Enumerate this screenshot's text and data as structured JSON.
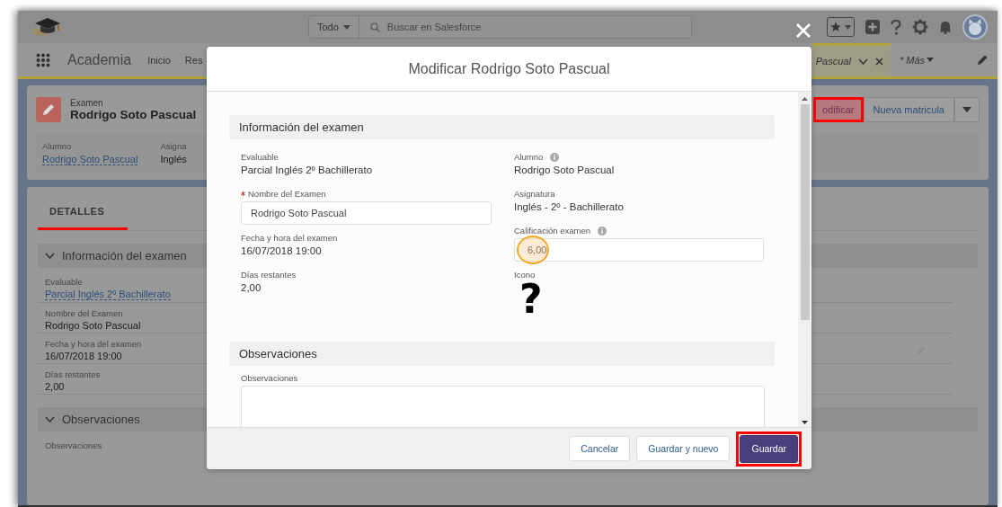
{
  "header": {
    "search_scope": "Todo",
    "search_placeholder": "Buscar en Salesforce"
  },
  "nav": {
    "app_name": "Academia",
    "items": [
      {
        "label": "Inicio",
        "selected": false
      },
      {
        "label": "Res",
        "selected": false
      }
    ],
    "open_tab": {
      "label": "Pascual",
      "selected": true
    },
    "more": "* Más"
  },
  "record": {
    "type": "Examen",
    "name": "Rodrigo Soto Pascual",
    "actions": [
      {
        "label": "odificar",
        "highlighted": true
      },
      {
        "label": "Nueva matricula",
        "highlighted": false
      }
    ],
    "fields": [
      {
        "label": "Alumno",
        "value": "Rodrigo Soto Pascual",
        "link": true
      },
      {
        "label": "Asigna",
        "value": "Inglés",
        "link": false
      }
    ]
  },
  "details": {
    "tab": {
      "label": "DETALLES",
      "selected": true
    },
    "sections": [
      {
        "title": "Información del examen",
        "fields": [
          {
            "label": "Evaluable",
            "value": "Parcial Inglés 2º Bachillerato",
            "link": true
          },
          {
            "label": "Nombre del Examen",
            "value": "Rodrigo Soto Pascual",
            "link": false
          },
          {
            "label": "Fecha y hora del examen",
            "value": "16/07/2018 19:00",
            "link": false
          },
          {
            "label": "Días restantes",
            "value": "2,00",
            "link": false
          }
        ]
      },
      {
        "title": "Observaciones",
        "fields": [
          {
            "label": "Observaciones"
          }
        ]
      }
    ]
  },
  "modal": {
    "title": "Modificar Rodrigo Soto Pascual",
    "sections": [
      {
        "title": "Información del examen",
        "columns": [
          [
            {
              "kind": "text",
              "label": "Evaluable",
              "value": "Parcial Inglés 2º Bachillerato"
            },
            {
              "kind": "input",
              "label": "Nombre del Examen",
              "value": "Rodrigo Soto Pascual",
              "required": true
            },
            {
              "kind": "text",
              "label": "Fecha y hora del examen",
              "value": "16/07/2018 19:00"
            },
            {
              "kind": "text",
              "label": "Días restantes",
              "value": "2,00"
            }
          ],
          [
            {
              "kind": "text",
              "label": "Alumno",
              "value": "Rodrigo Soto Pascual",
              "info": true
            },
            {
              "kind": "text",
              "label": "Asignatura",
              "value": "Inglés - 2º - Bachillerato"
            },
            {
              "kind": "input",
              "label": "Calificación examen",
              "value": "6,00",
              "info": true,
              "highlighted": true
            },
            {
              "kind": "symbol",
              "label": "Icono",
              "value": "?"
            }
          ]
        ]
      },
      {
        "title": "Observaciones",
        "columns": [
          [
            {
              "kind": "textarea",
              "label": "Observaciones"
            }
          ]
        ]
      }
    ],
    "buttons": [
      {
        "label": "Cancelar",
        "kind": "neutral",
        "highlighted": false
      },
      {
        "label": "Guardar y nuevo",
        "kind": "neutral",
        "highlighted": false
      },
      {
        "label": "Guardar",
        "kind": "brand",
        "highlighted": true
      }
    ]
  }
}
